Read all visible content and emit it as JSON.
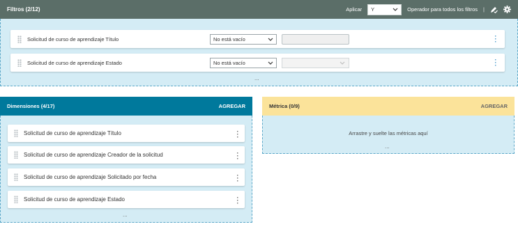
{
  "filters": {
    "title": "Filtros (2/12)",
    "apply_label": "Aplicar",
    "apply_value": "Y",
    "operator_label": "Operador para todos los filtros",
    "separator": "|",
    "rows": [
      {
        "label": "Solicitud de curso de aprendizaje Título",
        "operator": "No está vacío"
      },
      {
        "label": "Solicitud de curso de aprendizaje Estado",
        "operator": "No está vacío"
      }
    ],
    "more": "..."
  },
  "dimensions": {
    "title": "Dimensiones (4/17)",
    "action": "AGREGAR",
    "items": [
      "Solicitud de curso de aprendizaje Título",
      "Solicitud de curso de aprendizaje Creador de la solicitud",
      "Solicitud de curso de aprendizaje Solicitado por fecha",
      "Solicitud de curso de aprendizaje Estado"
    ],
    "more": "..."
  },
  "metrics": {
    "title": "Métrica (0/9)",
    "action": "AGREGAR",
    "drop_hint": "Arrastre y suelte las métricas aquí",
    "more": "..."
  },
  "icons": {
    "drag": "drag-handle-icon",
    "kebab": "more-vertical-icon",
    "chevron": "chevron-down-icon",
    "edit": "pencil-check-icon",
    "settings": "gear-icon"
  },
  "colors": {
    "filters_header": "#5b6e68",
    "dimensions_header": "#00799c",
    "metrics_header": "#fbe39a",
    "panel_body": "#d4ecf5",
    "accent": "#2f8bc4"
  }
}
